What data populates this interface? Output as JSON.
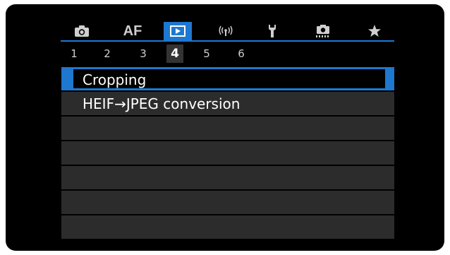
{
  "tabs": [
    {
      "id": "shooting",
      "icon": "camera-icon",
      "label": "",
      "selected": false
    },
    {
      "id": "af",
      "icon": "",
      "label": "AF",
      "selected": false
    },
    {
      "id": "playback",
      "icon": "playback-icon",
      "label": "",
      "selected": true
    },
    {
      "id": "wireless",
      "icon": "wireless-icon",
      "label": "",
      "selected": false
    },
    {
      "id": "setup",
      "icon": "wrench-icon",
      "label": "",
      "selected": false
    },
    {
      "id": "custom",
      "icon": "custom-functions-icon",
      "label": "",
      "selected": false
    },
    {
      "id": "mymenu",
      "icon": "star-icon",
      "label": "",
      "selected": false
    }
  ],
  "tab_labels": {
    "af": "AF"
  },
  "pages": [
    "1",
    "2",
    "3",
    "4",
    "5",
    "6"
  ],
  "selected_page": "4",
  "menu": {
    "items": [
      {
        "label": "Cropping",
        "selected": true
      },
      {
        "label": "HEIF→JPEG conversion",
        "selected": false
      },
      {
        "label": "",
        "selected": false
      },
      {
        "label": "",
        "selected": false
      },
      {
        "label": "",
        "selected": false
      },
      {
        "label": "",
        "selected": false
      },
      {
        "label": "",
        "selected": false
      }
    ]
  },
  "colors": {
    "accent": "#1e78d0",
    "background": "#000000",
    "row": "#2c2c2c",
    "text": "#ffffff"
  }
}
